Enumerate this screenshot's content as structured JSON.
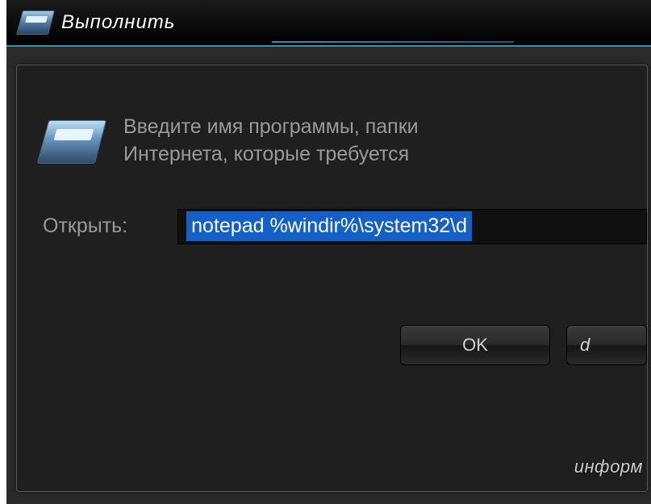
{
  "titlebar": {
    "title": "Выполнить"
  },
  "dialog": {
    "description_line1": "Введите имя программы, папки",
    "description_line2": "Интернета, которые требуется",
    "open_label": "Открыть:",
    "input_value": "notepad %windir%\\system32\\d"
  },
  "buttons": {
    "ok": "OK",
    "cancel_partial": "d"
  },
  "watermark": "информ"
}
